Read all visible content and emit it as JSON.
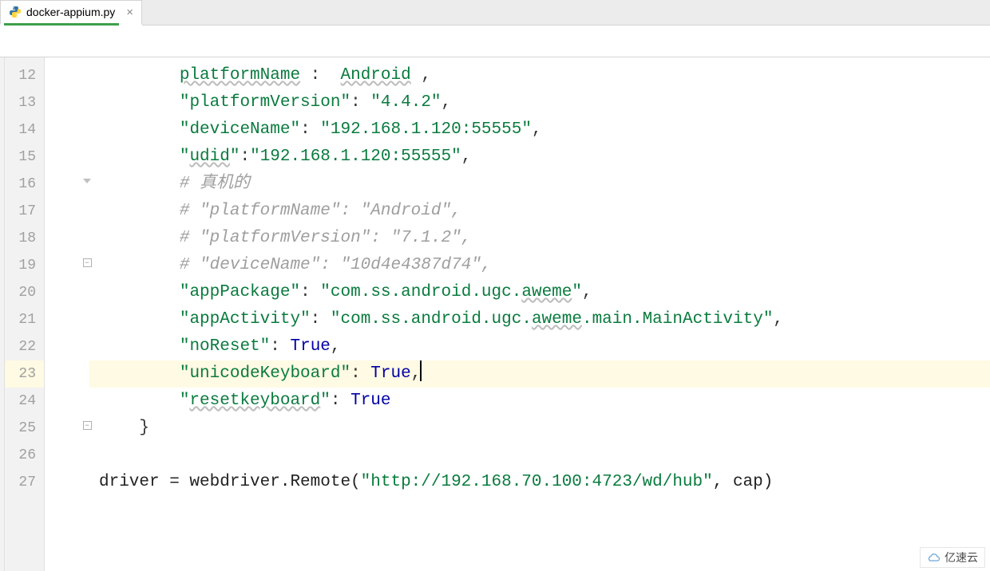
{
  "tab": {
    "filename": "docker-appium.py"
  },
  "gutter": {
    "start": 12,
    "end": 27,
    "current": 23
  },
  "code": {
    "l12": {
      "key": "platformName",
      "val": "Android"
    },
    "l13": {
      "key": "platformVersion",
      "val": "4.4.2"
    },
    "l14": {
      "key": "deviceName",
      "val": "192.168.1.120:55555"
    },
    "l15": {
      "key": "udid",
      "val": "192.168.1.120:55555"
    },
    "l16": {
      "comment": "# 真机的"
    },
    "l17": {
      "comment": "# \"platformName\": \"Android\","
    },
    "l18": {
      "comment": "# \"platformVersion\": \"7.1.2\","
    },
    "l19": {
      "comment": "# \"deviceName\": \"10d4e4387d74\","
    },
    "l20": {
      "key": "appPackage",
      "val": "com.ss.android.ugc.",
      "val_u": "aweme"
    },
    "l21": {
      "key": "appActivity",
      "val1": "com.ss.android.ugc.",
      "val_u": "aweme",
      "val2": ".main.MainActivity"
    },
    "l22": {
      "key": "noReset",
      "bool": "True"
    },
    "l23": {
      "key": "unicodeKeyboard",
      "bool": "True"
    },
    "l24": {
      "key": "resetkeyboard",
      "bool": "True"
    },
    "l25": {
      "brace": "}"
    },
    "l27": {
      "pre": "driver = webdriver.Remote(",
      "url": "http://192.168.70.100:4723/wd/hub",
      "post": ", cap)"
    }
  },
  "watermark": {
    "text": "亿速云"
  }
}
